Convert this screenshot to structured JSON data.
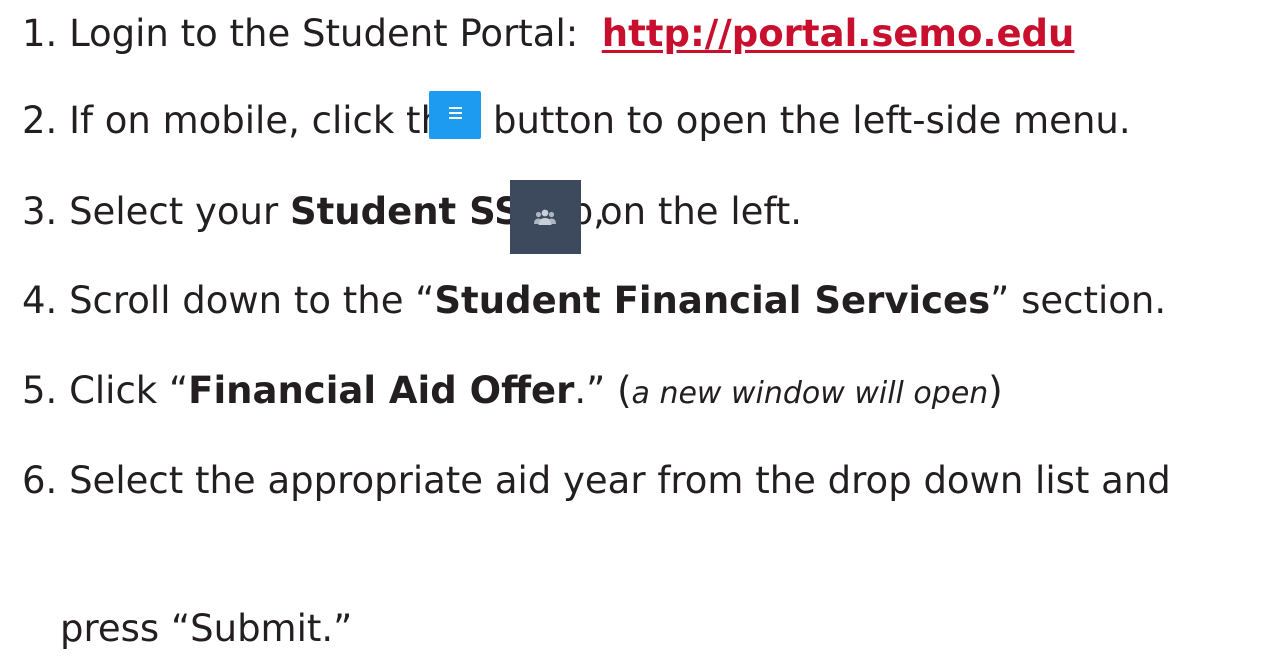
{
  "steps": {
    "s1": {
      "text": "1. Login to the Student Portal:",
      "link": "http://portal.semo.edu"
    },
    "s2": {
      "before": "2. If on mobile, click the",
      "after": "button to open the left-side menu."
    },
    "s3": {
      "before": "3. Select your",
      "bold": "Student SS",
      "mid": "tab,",
      "after": "on the left."
    },
    "s4": {
      "before": "4. Scroll down to the “",
      "bold": "Student Financial Services",
      "after": "” section."
    },
    "s5": {
      "before": "5. Click “",
      "bold": "Financial Aid Offer",
      "mid": ".” (",
      "italic": "a new window will open",
      "after": ")"
    },
    "s6": {
      "line1": "6. Select the appropriate aid year from the drop down list and",
      "line2": "press “Submit.”"
    }
  },
  "icons": {
    "menu": "hamburger-menu-icon",
    "tab": "users-group-icon"
  },
  "colors": {
    "link": "#c8102e",
    "menu_button": "#1d9bf0",
    "tab_button": "#3d4a5e"
  }
}
